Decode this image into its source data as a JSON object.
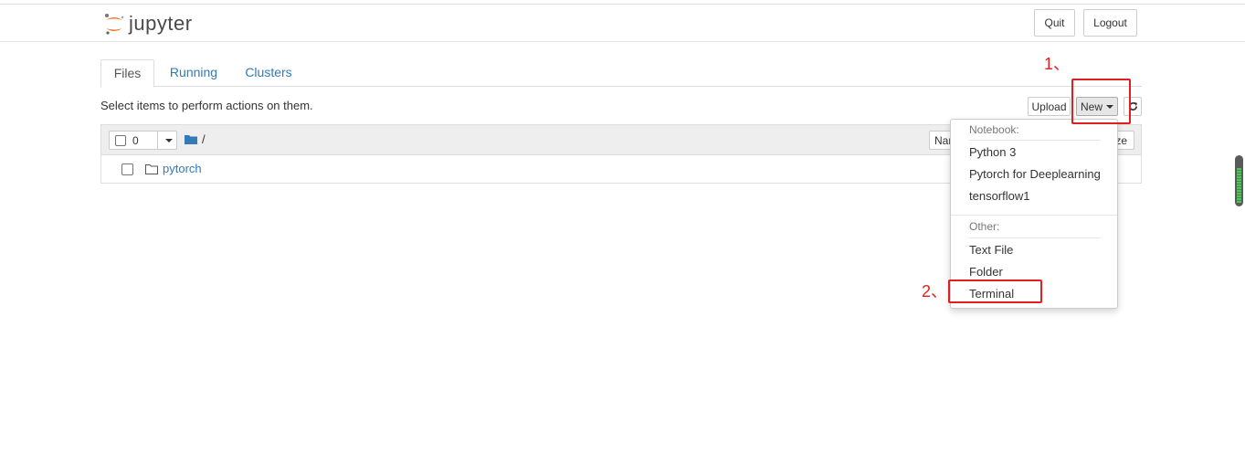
{
  "header": {
    "logo_text": "jupyter",
    "quit_label": "Quit",
    "logout_label": "Logout"
  },
  "tabs": [
    {
      "label": "Files"
    },
    {
      "label": "Running"
    },
    {
      "label": "Clusters"
    }
  ],
  "toolbar": {
    "hint": "Select items to perform actions on them.",
    "upload_label": "Upload",
    "new_label": "New"
  },
  "listing": {
    "selected_count": "0",
    "breadcrumb": "/",
    "name_sort_partial": "Nam",
    "size_sort_partial": "ze",
    "rows": [
      {
        "name": "pytorch",
        "type": "folder"
      }
    ]
  },
  "new_menu": {
    "notebook_header": "Notebook:",
    "notebook_items": [
      "Python 3",
      "Pytorch for Deeplearning",
      "tensorflow1"
    ],
    "other_header": "Other:",
    "other_items": [
      "Text File",
      "Folder",
      "Terminal"
    ]
  },
  "annotations": {
    "step1": "1、",
    "step2": "2、",
    "color": "#e02020"
  },
  "colors": {
    "link": "#337ab7",
    "logo_orange": "#f37626"
  }
}
